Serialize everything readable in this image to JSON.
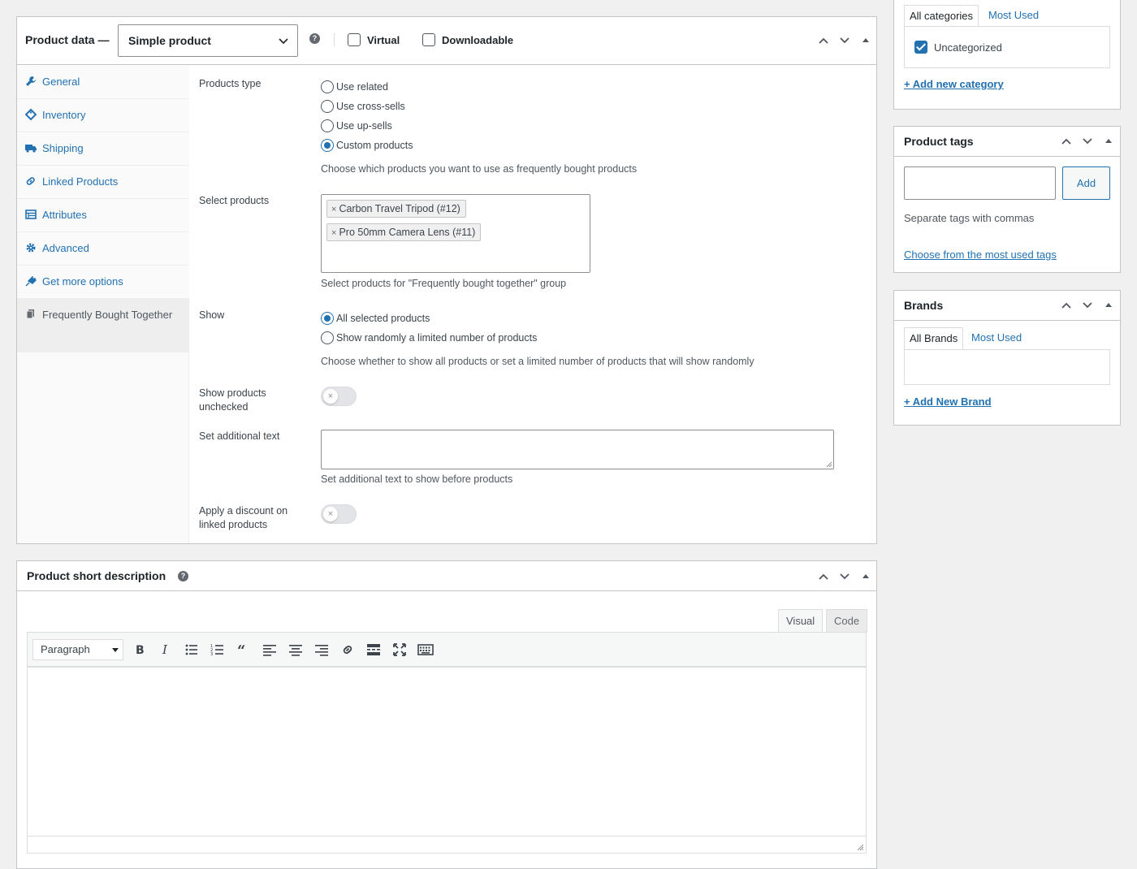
{
  "product_data": {
    "title": "Product data —",
    "type_select": "Simple product",
    "help": "?",
    "virtual_label": "Virtual",
    "downloadable_label": "Downloadable",
    "tabs": [
      {
        "label": "General",
        "icon": "wrench-icon"
      },
      {
        "label": "Inventory",
        "icon": "tag-icon"
      },
      {
        "label": "Shipping",
        "icon": "truck-icon"
      },
      {
        "label": "Linked Products",
        "icon": "link-icon"
      },
      {
        "label": "Attributes",
        "icon": "table-icon"
      },
      {
        "label": "Advanced",
        "icon": "gear-icon"
      },
      {
        "label": "Get more options",
        "icon": "plugin-icon"
      },
      {
        "label": "Frequently Bought Together",
        "icon": "copy-icon"
      }
    ],
    "fields": {
      "products_type": {
        "label": "Products type",
        "options": [
          "Use related",
          "Use cross-sells",
          "Use up-sells",
          "Custom products"
        ],
        "selected": "Custom products",
        "description": "Choose which products you want to use as frequently bought products"
      },
      "select_products": {
        "label": "Select products",
        "chips": [
          "Carbon Travel Tripod (#12)",
          "Pro 50mm Camera Lens (#11)"
        ],
        "chip_remove": "×",
        "description": "Select products for \"Frequently bought together\" group"
      },
      "show": {
        "label": "Show",
        "options": [
          "All selected products",
          "Show randomly a limited number of products"
        ],
        "selected": "All selected products",
        "description": "Choose whether to show all products or set a limited number of products that will show randomly"
      },
      "show_unchecked": {
        "label_line1": "Show products",
        "label_line2": "unchecked",
        "on": false
      },
      "additional_text": {
        "label": "Set additional text",
        "value": "",
        "description": "Set additional text to show before products"
      },
      "discount": {
        "label_line1": "Apply a discount on",
        "label_line2": "linked products",
        "on": false
      }
    }
  },
  "short_description": {
    "title": "Product short description",
    "help": "?",
    "tab_visual": "Visual",
    "tab_code": "Code",
    "format_select": "Paragraph",
    "content": ""
  },
  "categories": {
    "tab_all": "All categories",
    "tab_most_used": "Most Used",
    "items": [
      {
        "label": "Uncategorized",
        "checked": true
      }
    ],
    "add_link": "+ Add new category"
  },
  "product_tags": {
    "title": "Product tags",
    "input_value": "",
    "add_button": "Add",
    "hint": "Separate tags with commas",
    "choose_link": "Choose from the most used tags"
  },
  "brands": {
    "title": "Brands",
    "tab_all": "All Brands",
    "tab_most_used": "Most Used",
    "add_link": "+ Add New Brand"
  },
  "colors": {
    "accent": "#2271b1",
    "border": "#c3c4c7",
    "background": "#f0f0f1"
  }
}
